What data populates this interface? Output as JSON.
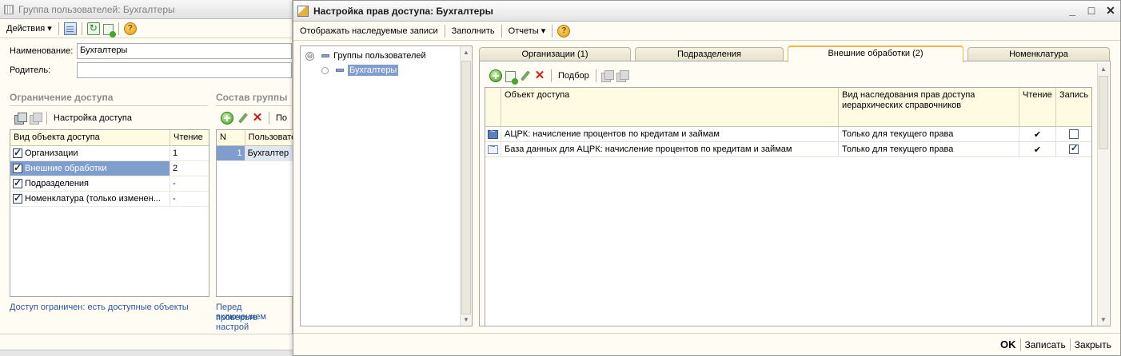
{
  "bg_window": {
    "title": "Группа пользователей: Бухгалтеры",
    "toolbar": {
      "actions": "Действия ▾",
      "help": "?"
    },
    "name_label": "Наименование:",
    "name_value": "Бухгалтеры",
    "parent_label": "Родитель:",
    "parent_value": "",
    "access_section": "Ограничение доступа",
    "group_section": "Состав группы",
    "access_toolbar_label": "Настройка доступа",
    "access_grid": {
      "headers": [
        "Вид объекта доступа",
        "Чтение"
      ],
      "rows": [
        {
          "name": "Организации",
          "checked": true,
          "value": "1"
        },
        {
          "name": "Внешние обработки",
          "checked": true,
          "value": "2"
        },
        {
          "name": "Подразделения",
          "checked": true,
          "value": "-"
        },
        {
          "name": "Номенклатура (только изменен...",
          "checked": true,
          "value": "-"
        }
      ]
    },
    "group_toolbar_label": "По",
    "group_grid": {
      "headers": [
        "N",
        "Пользовате"
      ],
      "rows": [
        {
          "n": "1",
          "user": "Бухгалтер"
        }
      ]
    },
    "access_note": "Доступ ограничен: есть доступные объекты",
    "group_note_1": "Перед включением",
    "group_note_2": "проверьте настрой"
  },
  "dialog": {
    "title": "Настройка прав доступа: Бухгалтеры",
    "window_buttons": {
      "minimize": "_",
      "maximize": "□",
      "close": "✕"
    },
    "toolbar": {
      "show_inherited": "Отображать наследуемые записи",
      "fill": "Заполнить",
      "reports": "Отчеты ▾",
      "help": "?"
    },
    "tree": {
      "root": "Группы пользователей",
      "child": "Бухгалтеры",
      "collapse_symbol": "⊖"
    },
    "tabs": [
      {
        "label": "Организации (1)",
        "active": false
      },
      {
        "label": "Подразделения",
        "active": false
      },
      {
        "label": "Внешние обработки (2)",
        "active": true
      },
      {
        "label": "Номенклатура",
        "active": false
      }
    ],
    "panel_toolbar": {
      "select": "Подбор"
    },
    "grid": {
      "headers": {
        "object": "Объект доступа",
        "inheritance": "Вид наследования прав доступа иерархических справочников",
        "read": "Чтение",
        "write": "Запись"
      },
      "rows": [
        {
          "object": "АЦРК: начисление процентов по кредитам и займам",
          "inheritance": "Только для текущего права",
          "read": "✔",
          "write": false
        },
        {
          "object": "База данных для АЦРК: начисление процентов по кредитам и займам",
          "inheritance": "Только для текущего права",
          "read": "✔",
          "write": true
        }
      ]
    },
    "bottom": {
      "ok": "OK",
      "save": "Записать",
      "close": "Закрыть"
    }
  }
}
